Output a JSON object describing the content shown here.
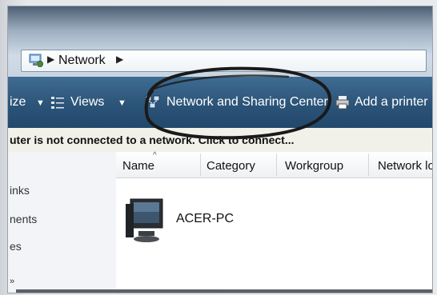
{
  "address_bar": {
    "icon": "network-folder-icon",
    "breadcrumb": "Network"
  },
  "toolbar": {
    "organize_partial": "ize",
    "views_label": "Views",
    "network_sharing_label": "Network and Sharing Center",
    "add_printer_label": "Add a printer"
  },
  "infobar": {
    "message": "uter is not connected to a network. Click to connect..."
  },
  "nav": {
    "items": [
      "inks",
      "nents",
      "es"
    ]
  },
  "columns": [
    "Name",
    "Category",
    "Workgroup",
    "Network lo"
  ],
  "items": [
    {
      "name": "ACER-PC",
      "icon": "computer-icon"
    }
  ],
  "colors": {
    "toolbar_bg": "#2c5478",
    "address_bg": "#ffffff",
    "annotation_ink": "#1a1a1a"
  }
}
